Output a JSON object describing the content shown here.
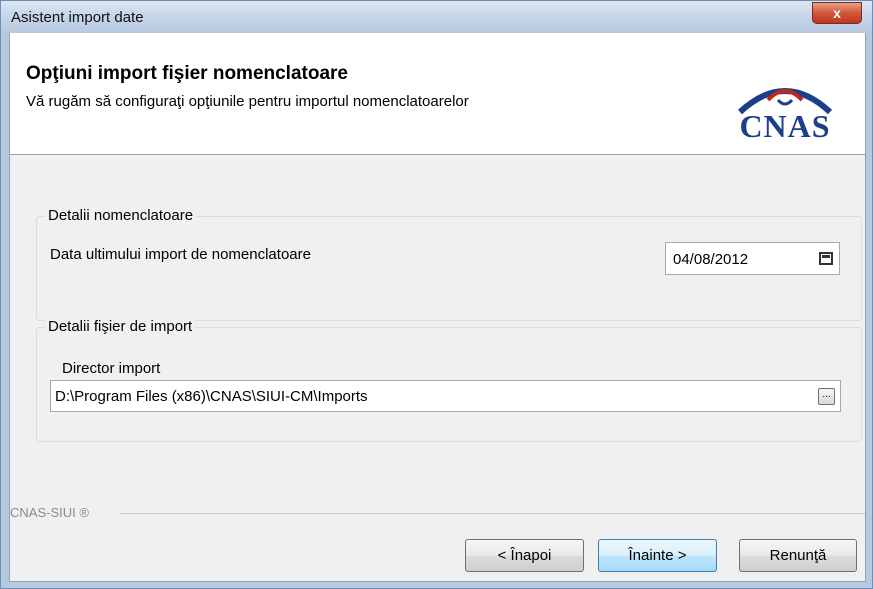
{
  "window": {
    "title": "Asistent import date",
    "close_label": "x"
  },
  "header": {
    "title": "Opţiuni import fişier nomenclatoare",
    "subtitle": "Vă rugăm să configuraţi opţiunile pentru importul nomenclatoarelor",
    "logo_text": "CNAS",
    "logo_color": "#1d3f8a",
    "logo_accent": "#c0281c"
  },
  "group_nomenclature": {
    "legend": "Detalii nomenclatoare",
    "label": "Data ultimului import de nomenclatoare",
    "date_value": "04/08/2012",
    "calendar_icon": "calendar-icon"
  },
  "group_import_file": {
    "legend": "Detalii fişier de import",
    "label": "Director import",
    "path_value": "D:\\Program Files (x86)\\CNAS\\SIUI-CM\\Imports",
    "browse_label": "..."
  },
  "footer": {
    "brand": "CNAS-SIUI ®"
  },
  "buttons": {
    "back": "< Înapoi",
    "next": "Înainte >",
    "cancel": "Renunţă"
  }
}
